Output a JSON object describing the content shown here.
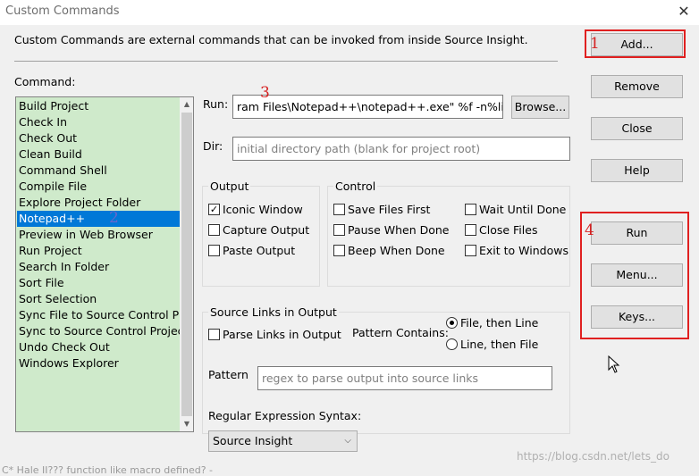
{
  "window": {
    "title": "Custom Commands",
    "close_glyph": "✕"
  },
  "description": "Custom Commands are external commands that can be invoked from inside Source Insight.",
  "command_label": "Command:",
  "commands": [
    "Build Project",
    "Check In",
    "Check Out",
    "Clean Build",
    "Command Shell",
    "Compile File",
    "Explore Project Folder",
    "Notepad++",
    "Preview in Web Browser",
    "Run Project",
    "Search In Folder",
    "Sort File",
    "Sort Selection",
    "Sync File to Source Control Pro",
    "Sync to Source Control Project",
    "Undo Check Out",
    "Windows Explorer"
  ],
  "selected_command": "Notepad++",
  "run": {
    "label": "Run:",
    "value": "ram Files\\Notepad++\\notepad++.exe\" %f -n%line",
    "browse": "Browse..."
  },
  "dir": {
    "label": "Dir:",
    "placeholder": "initial directory path (blank for project root)"
  },
  "output": {
    "title": "Output",
    "iconic_window": "Iconic Window",
    "capture_output": "Capture Output",
    "paste_output": "Paste Output",
    "iconic_checked": true
  },
  "control": {
    "title": "Control",
    "save_files_first": "Save Files First",
    "pause_when_done": "Pause When Done",
    "beep_when_done": "Beep When Done",
    "wait_until_done": "Wait Until Done",
    "close_files": "Close Files",
    "exit_to_windows": "Exit to Windows"
  },
  "source_links": {
    "title": "Source Links in Output",
    "parse_links": "Parse Links in Output",
    "pattern_contains": "Pattern Contains:",
    "file_then_line": "File, then Line",
    "line_then_file": "Line, then File",
    "pattern_label": "Pattern",
    "pattern_placeholder": "regex to parse output into source links",
    "regex_syntax_label": "Regular Expression Syntax:",
    "regex_syntax_value": "Source Insight"
  },
  "buttons": {
    "add": "Add...",
    "remove": "Remove",
    "close": "Close",
    "help": "Help",
    "run": "Run",
    "menu": "Menu...",
    "keys": "Keys..."
  },
  "annotations": {
    "a1": "1",
    "a2": "2",
    "a3": "3",
    "a4": "4"
  },
  "annotation_colors": {
    "red": "#e02020",
    "blue": "#6666cc"
  },
  "watermark": "https://blog.csdn.net/lets_do",
  "background_snippet": "C* Hale II??? function like macro defined? -",
  "icons": {
    "close": "close-icon",
    "checkmark": "check-icon",
    "dropdown": "chevron-down-icon",
    "cursor": "mouse-cursor-icon"
  }
}
